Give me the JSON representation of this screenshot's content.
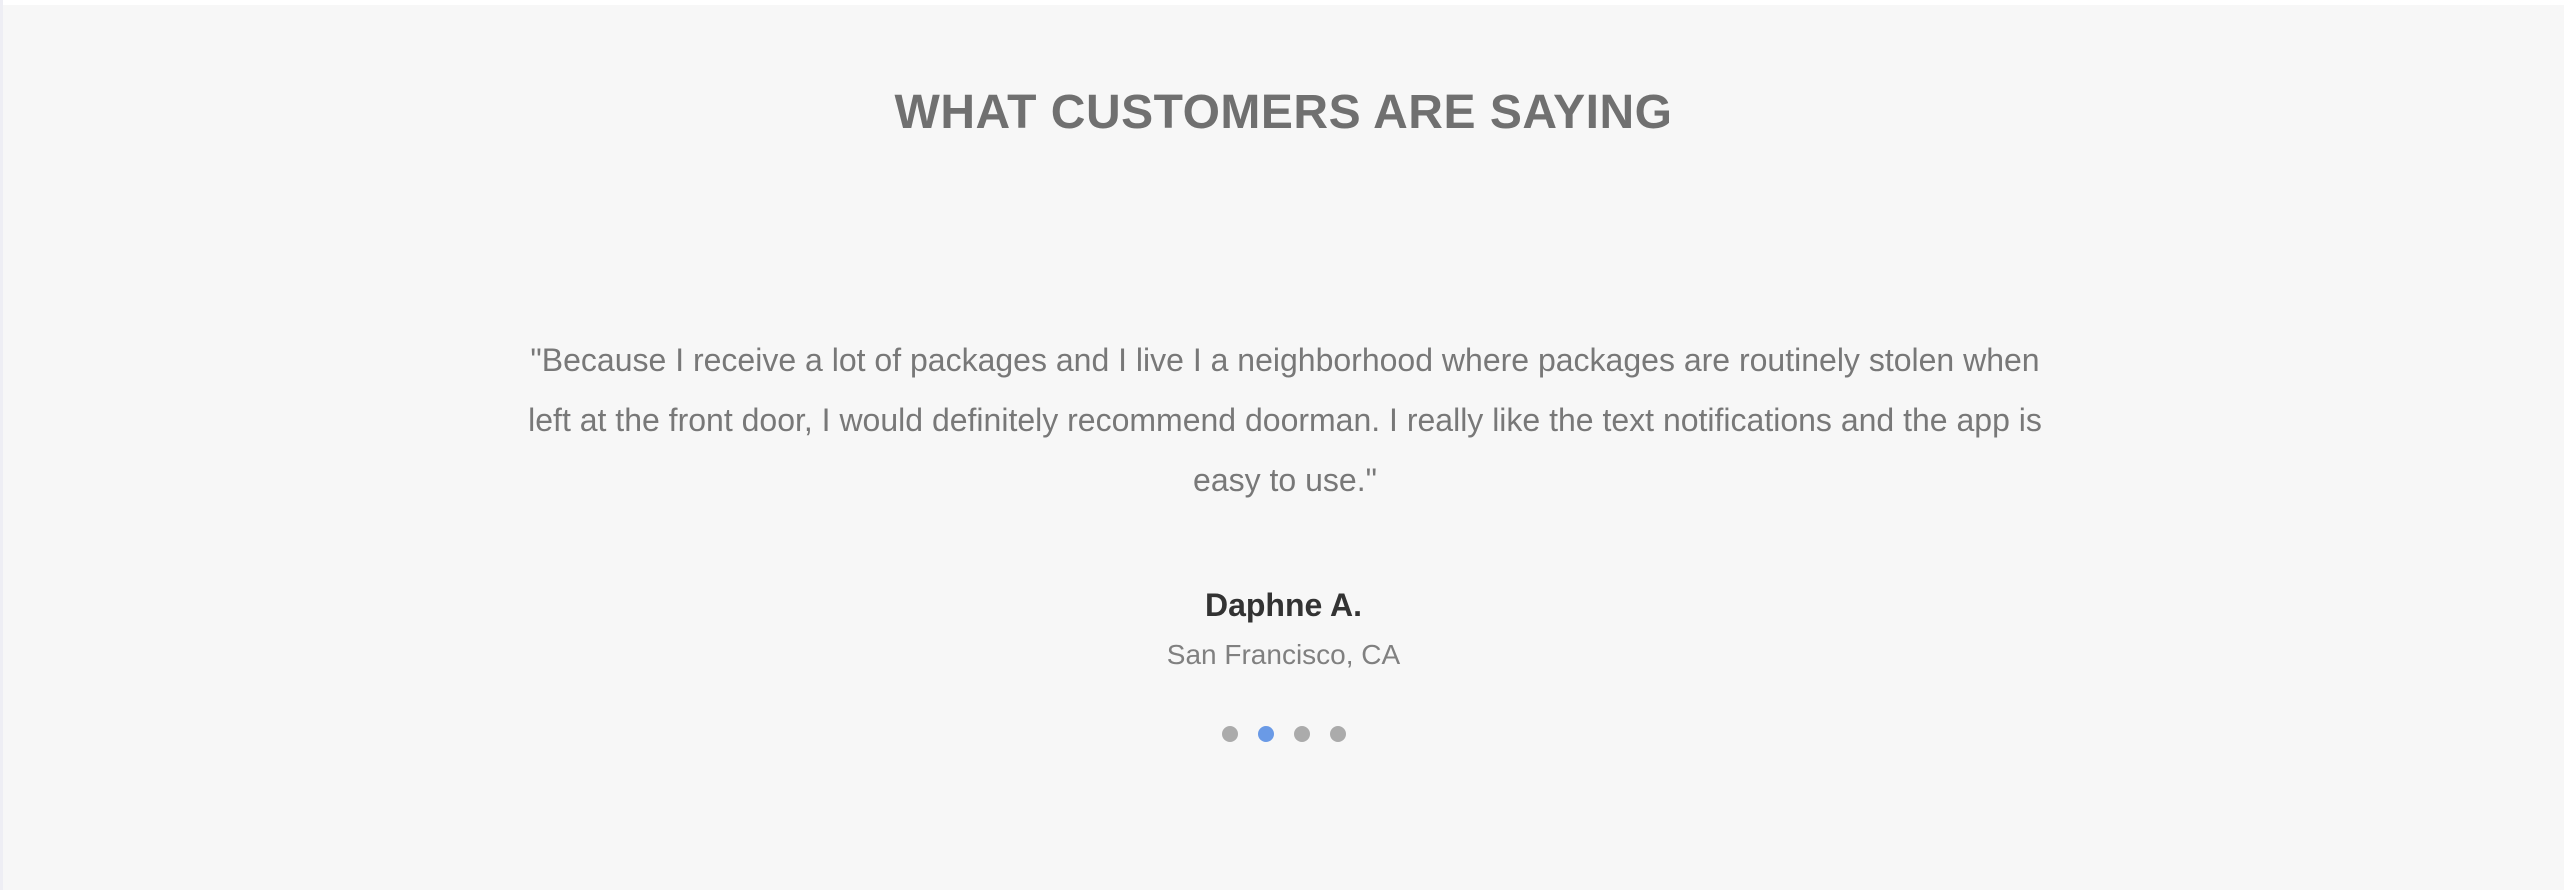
{
  "testimonials": {
    "heading": "WHAT CUSTOMERS ARE SAYING",
    "quote": "\"Because I receive a lot of packages and I live I a neighborhood where packages are routinely stolen when left at the front door, I would definitely recommend doorman. I really like the text notifications and the app is easy to use.\"",
    "author": "Daphne A.",
    "location": "San Francisco, CA",
    "slide_count": 4,
    "active_slide": 2,
    "colors": {
      "background": "#f7f7f7",
      "dot": "#ababab",
      "dot_active": "#6a9ae6"
    }
  }
}
